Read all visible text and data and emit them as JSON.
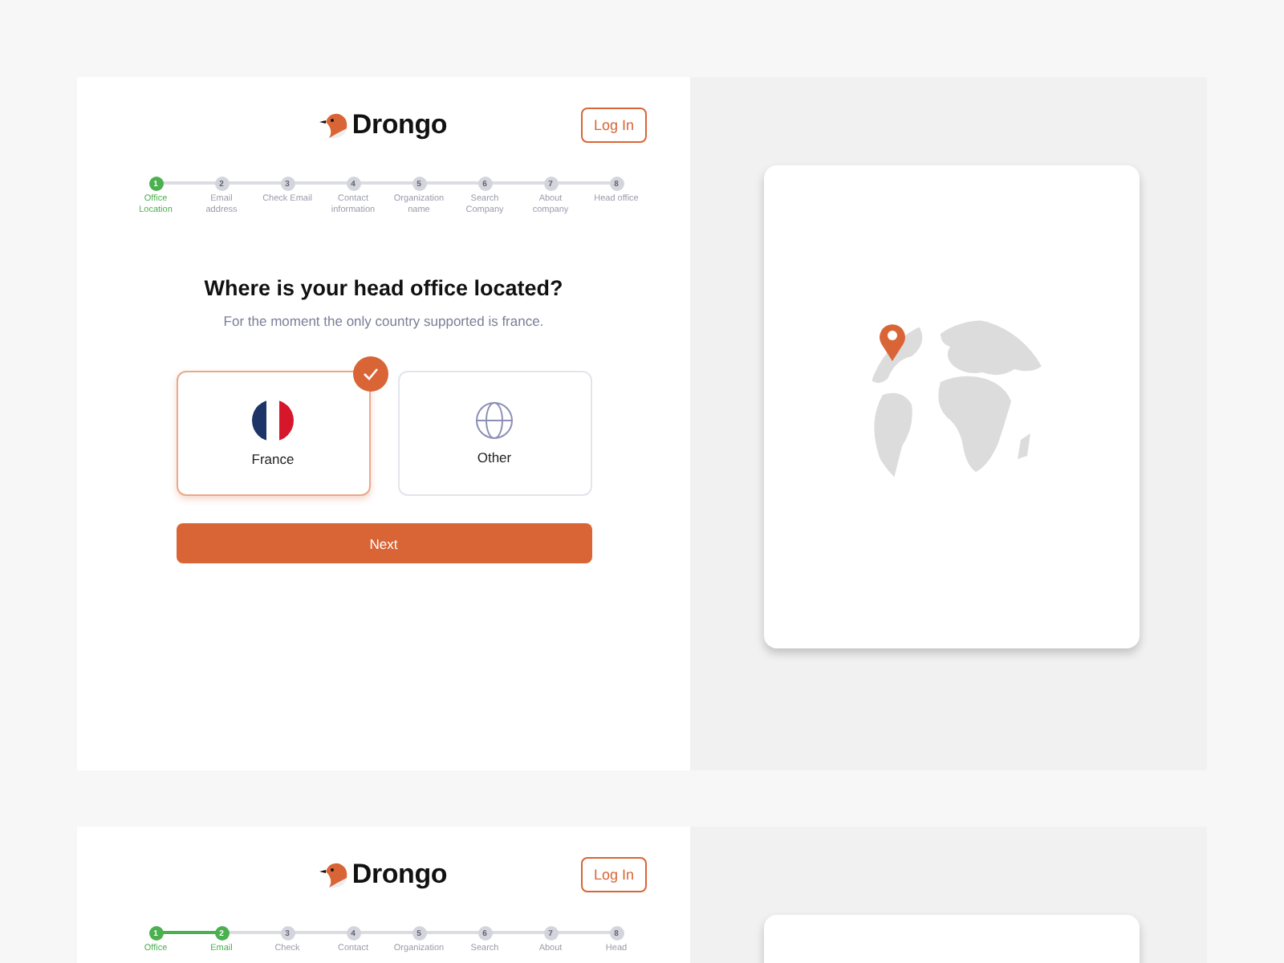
{
  "screens": [
    {
      "logo": "Drongo",
      "login": "Log In",
      "steps": [
        {
          "number": "1",
          "label": "Office Location",
          "active": true
        },
        {
          "number": "2",
          "label": "Email address",
          "active": false
        },
        {
          "number": "3",
          "label": "Check Email",
          "active": false
        },
        {
          "number": "4",
          "label": "Contact information",
          "active": false
        },
        {
          "number": "5",
          "label": "Organization name",
          "active": false
        },
        {
          "number": "6",
          "label": "Search Company",
          "active": false
        },
        {
          "number": "7",
          "label": "About company",
          "active": false
        },
        {
          "number": "8",
          "label": "Head office",
          "active": false
        }
      ],
      "question": "Where is your head office located?",
      "subtitle": "For the moment the only country supported is france.",
      "options": [
        {
          "kind": "flag",
          "label": "France",
          "selected": true
        },
        {
          "kind": "globe",
          "label": "Other",
          "selected": false
        }
      ],
      "next": "Next"
    },
    {
      "logo": "Drongo",
      "login": "Log In",
      "steps": [
        {
          "number": "1",
          "label": "Office",
          "active": true
        },
        {
          "number": "2",
          "label": "Email",
          "active": true
        },
        {
          "number": "3",
          "label": "Check",
          "active": false
        },
        {
          "number": "4",
          "label": "Contact",
          "active": false
        },
        {
          "number": "5",
          "label": "Organization",
          "active": false
        },
        {
          "number": "6",
          "label": "Search",
          "active": false
        },
        {
          "number": "7",
          "label": "About",
          "active": false
        },
        {
          "number": "8",
          "label": "Head",
          "active": false
        }
      ]
    }
  ]
}
